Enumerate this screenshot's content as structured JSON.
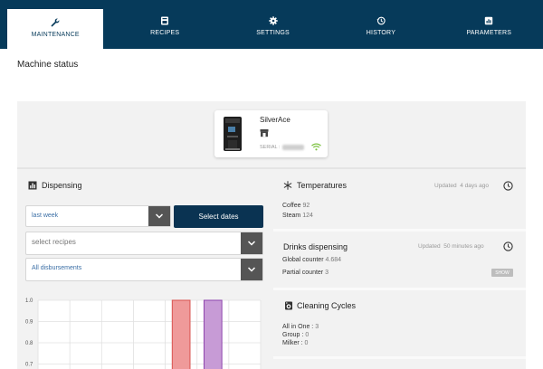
{
  "nav": {
    "tabs": [
      {
        "label": "MAINTENANCE",
        "icon": "wrench-icon",
        "active": true
      },
      {
        "label": "RECIPES",
        "icon": "coffee-machine-icon",
        "active": false
      },
      {
        "label": "SETTINGS",
        "icon": "gear-icon",
        "active": false
      },
      {
        "label": "HISTORY",
        "icon": "history-icon",
        "active": false
      },
      {
        "label": "PARAMETERS",
        "icon": "parameters-icon",
        "active": false
      }
    ]
  },
  "page": {
    "title": "Machine status"
  },
  "machine": {
    "name": "SilverAce",
    "serial_label": "SERIAL :",
    "serial_value": "888155",
    "connection": "wifi-connected"
  },
  "dispensing": {
    "title": "Dispensing",
    "period": "last week",
    "select_dates": "Select dates",
    "recipes_placeholder": "select recipes",
    "disbursements": "All disbursements"
  },
  "temperatures": {
    "title": "Temperatures",
    "updated_label": "Updated",
    "updated_value": "4 days ago",
    "coffee_label": "Coffee",
    "coffee_value": "92",
    "steam_label": "Steam",
    "steam_value": "124"
  },
  "drinks": {
    "title": "Drinks dispensing",
    "updated_label": "Updated",
    "updated_value": "50 minutes ago",
    "global_label": "Global counter",
    "global_value": "4.684",
    "partial_label": "Partial counter",
    "partial_value": "3",
    "show": "SHOW"
  },
  "cleaning": {
    "title": "Cleaning Cycles",
    "all_in_one_label": "All in One :",
    "all_in_one_value": "3",
    "group_label": "Group :",
    "group_value": "0",
    "milker_label": "Milker :",
    "milker_value": "0"
  },
  "chart_data": {
    "type": "bar",
    "ytick_labels": [
      "1.0",
      "0.9",
      "0.8",
      "0.7"
    ],
    "ylim": [
      0.7,
      1.0
    ],
    "categories": 7,
    "values": [
      0,
      0,
      0,
      0,
      1,
      1,
      0
    ],
    "bar_colors": [
      "#e57373",
      "#e57373",
      "#e57373",
      "#e57373",
      "#e57373",
      "#b07cc6",
      "#b07cc6"
    ],
    "grid": true
  },
  "colors": {
    "nav_bg": "#063a5a",
    "primary_btn": "#0a3352",
    "accent_green": "#7dc242"
  }
}
